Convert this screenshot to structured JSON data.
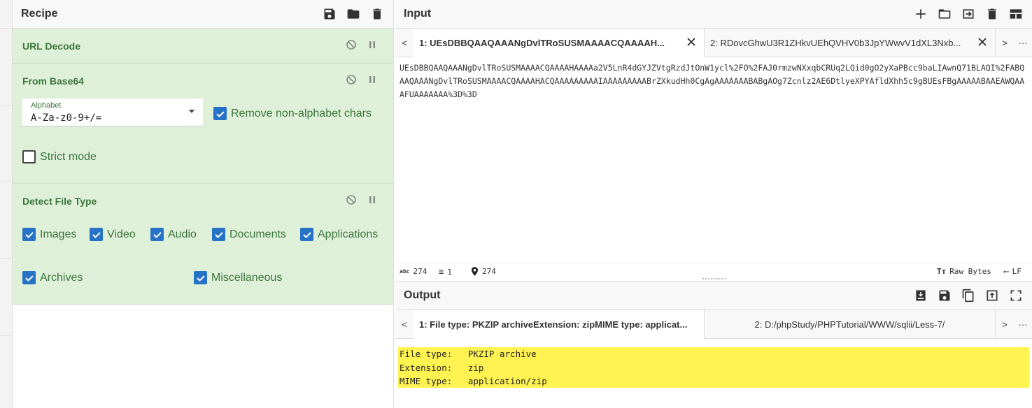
{
  "recipe": {
    "title": "Recipe",
    "ops": [
      {
        "title": "URL Decode"
      },
      {
        "title": "From Base64",
        "alphabet_label": "Alphabet",
        "alphabet_value": "A-Za-z0-9+/=",
        "remove_non_alpha": "Remove non-alphabet chars",
        "strict_mode": "Strict mode"
      },
      {
        "title": "Detect File Type",
        "checks": [
          "Images",
          "Video",
          "Audio",
          "Documents",
          "Applications",
          "Archives",
          "Miscellaneous"
        ]
      }
    ]
  },
  "input": {
    "title": "Input",
    "tab_prev": "<",
    "tab_next": ">",
    "tab_more": "···",
    "tabs": [
      {
        "label": "1: UEsDBBQAAQAAANgDvlTRoSUSMAAAACQAAAAH..."
      },
      {
        "label": "2: RDovcGhwU3R1ZHkvUEhQVHV0b3JpYWwvV1dXL3Nxb..."
      }
    ],
    "text": "UEsDBBQAAQAAANgDvlTRoSUSMAAAACQAAAAHAAAAa2V5LnR4dGYJZVtgRzdJtOnW1ycl%2FO%2FAJ0rmzwNXxqbCRUq2LQid0gO2yXaPBcc9baLIAwnQ71BLAQI%2FABQAAQAAANgDvlTRoSUSMAAAACQAAAAHACQAAAAAAAAAIAAAAAAAAABrZXkudHh0CgAgAAAAAAABABgAOg7Zcnlz2AE6DtlyeXPYAfldXhh5c9gBUEsFBgAAAAABAAEAWQAAAFUAAAAAAA%3D%3D",
    "status": {
      "length": "274",
      "lines": "1",
      "position": "274",
      "raw_bytes": "Raw Bytes",
      "eol": "LF"
    }
  },
  "output": {
    "title": "Output",
    "tab_prev": "<",
    "tab_next": ">",
    "tab_more": "···",
    "tabs": [
      {
        "label": "1: File type: PKZIP archiveExtension: zipMIME type: applicat..."
      },
      {
        "label": "2: D:/phpStudy/PHPTutorial/WWW/sqlii/Less-7/"
      }
    ],
    "lines": [
      "File type:   PKZIP archive",
      "Extension:   zip",
      "MIME type:   application/zip"
    ]
  },
  "colors": {
    "op_bg": "#dff0d8",
    "op_text": "#3c763d",
    "checkbox": "#2672c7",
    "output_highlight": "#fff352"
  }
}
